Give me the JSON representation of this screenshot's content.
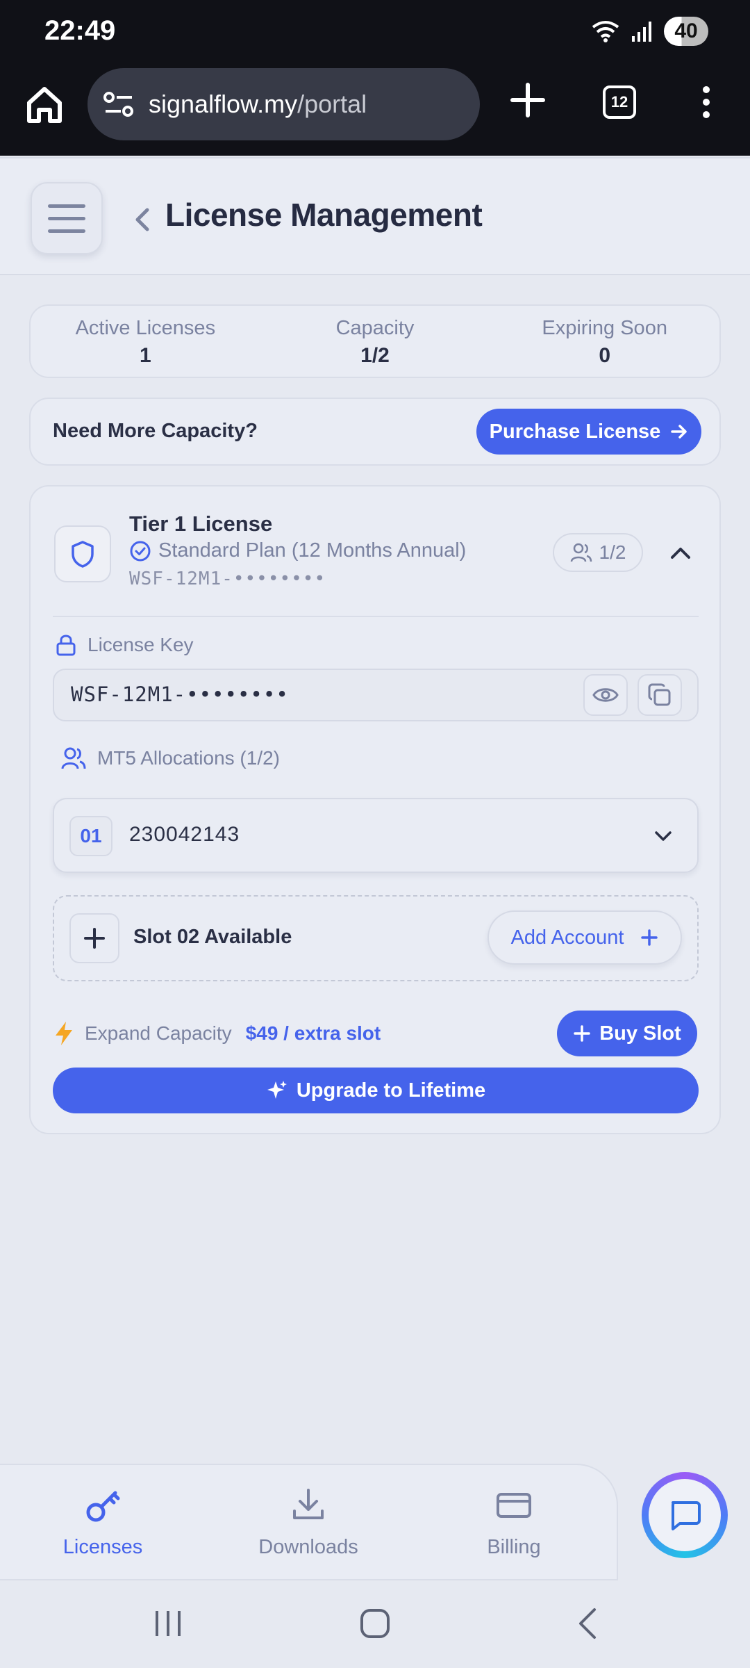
{
  "status_bar": {
    "time": "22:49",
    "battery": "40"
  },
  "browser": {
    "url_domain": "signalflow.my",
    "url_path": "/portal",
    "tab_count": "12"
  },
  "header": {
    "title": "License Management"
  },
  "stats": [
    {
      "label": "Active Licenses",
      "value": "1"
    },
    {
      "label": "Capacity",
      "value": "1/2"
    },
    {
      "label": "Expiring Soon",
      "value": "0"
    }
  ],
  "capacity_banner": {
    "text": "Need More Capacity?",
    "button": "Purchase License"
  },
  "license": {
    "title": "Tier 1 License",
    "plan": "Standard Plan (12 Months Annual)",
    "key_masked": "WSF-12M1-••••••••",
    "seats": "1/2",
    "key_label": "License Key",
    "key_value": "WSF-12M1-••••••••",
    "allocations_label": "MT5 Allocations (1/2)",
    "allocations": [
      {
        "slot": "01",
        "account": "230042143"
      }
    ],
    "empty_slot": {
      "text": "Slot 02 Available",
      "button": "Add Account"
    },
    "expand_label": "Expand Capacity",
    "expand_price": "$49 / extra slot",
    "buy_slot": "Buy Slot",
    "upgrade": "Upgrade to Lifetime"
  },
  "bottom_nav": [
    {
      "label": "Licenses",
      "icon": "key-icon",
      "active": true
    },
    {
      "label": "Downloads",
      "icon": "download-icon",
      "active": false
    },
    {
      "label": "Billing",
      "icon": "credit-card-icon",
      "active": false
    }
  ],
  "colors": {
    "accent": "#4563eb",
    "background": "#e6e9f1",
    "muted_text": "#7a82a0",
    "lightning": "#f5a623"
  }
}
